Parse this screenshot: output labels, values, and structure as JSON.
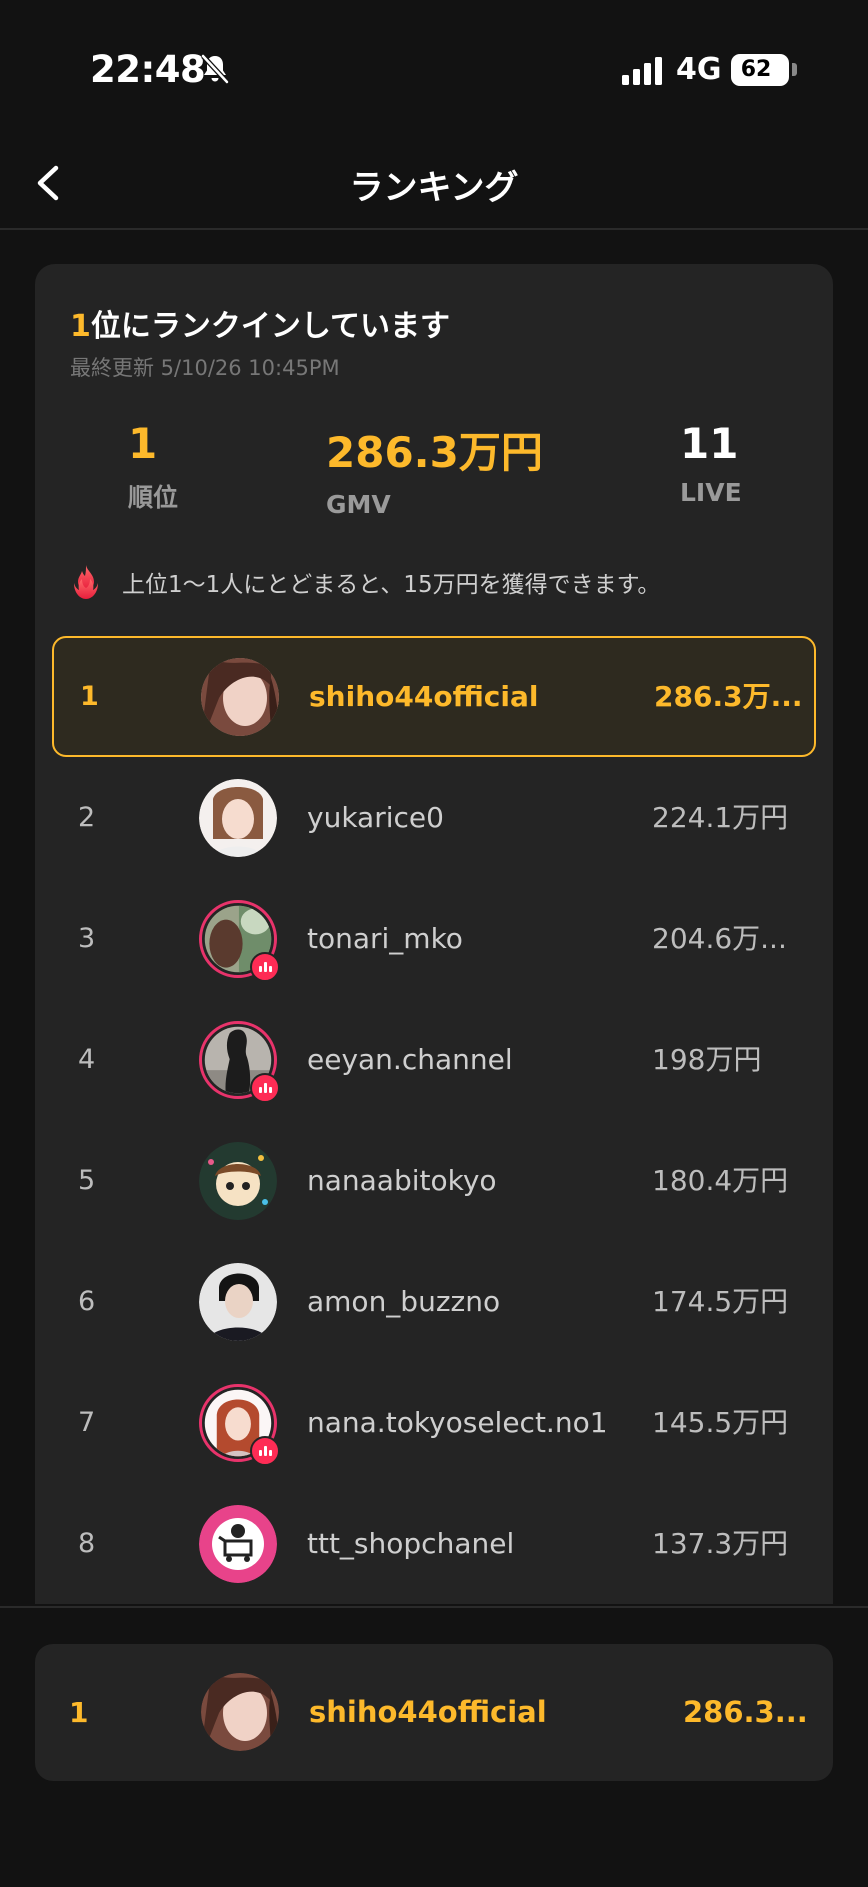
{
  "status_bar": {
    "time": "22:48",
    "network": "4G",
    "battery": "62",
    "icons": [
      "bell-muted-icon",
      "signal-icon",
      "battery-icon"
    ]
  },
  "nav": {
    "title": "ランキング",
    "back_icon": "chevron-left-icon"
  },
  "summary": {
    "rank_number": "1",
    "rank_text": "位にランクインしています",
    "updated": "最終更新 5/10/26 10:45PM",
    "stats": [
      {
        "value": "1",
        "label": "順位"
      },
      {
        "value": "286.3万円",
        "label": "GMV"
      },
      {
        "value": "11",
        "label": "LIVE"
      }
    ],
    "notice": "上位1〜1人にとどまると、15万円を獲得できます。",
    "notice_icon": "fire-icon"
  },
  "ranking": [
    {
      "rank": "1",
      "name": "shiho44official",
      "gmv": "286.3万...",
      "live": false,
      "me": true
    },
    {
      "rank": "2",
      "name": "yukarice0",
      "gmv": "224.1万円",
      "live": false,
      "me": false
    },
    {
      "rank": "3",
      "name": "tonari_mko",
      "gmv": "204.6万...",
      "live": true,
      "me": false
    },
    {
      "rank": "4",
      "name": "eeyan.channel",
      "gmv": "198万円",
      "live": true,
      "me": false
    },
    {
      "rank": "5",
      "name": "nanaabitokyo",
      "gmv": "180.4万円",
      "live": false,
      "me": false
    },
    {
      "rank": "6",
      "name": "amon_buzzno",
      "gmv": "174.5万円",
      "live": false,
      "me": false
    },
    {
      "rank": "7",
      "name": "nana.tokyoselect.no1",
      "gmv": "145.5万円",
      "live": true,
      "me": false
    },
    {
      "rank": "8",
      "name": "ttt_shopchanel",
      "gmv": "137.3万円",
      "live": false,
      "me": false
    }
  ],
  "my_entry": {
    "rank": "1",
    "name": "shiho44official",
    "gmv": "286.3..."
  },
  "colors": {
    "accent": "#fdb92b",
    "live": "#fe2c55",
    "background": "#121212",
    "card": "#242424"
  }
}
